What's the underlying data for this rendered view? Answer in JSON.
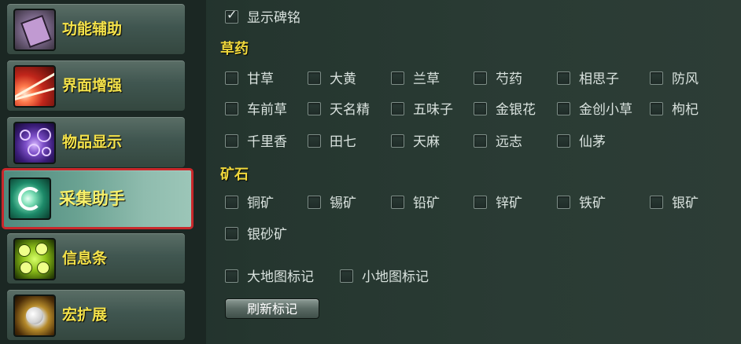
{
  "sidebar": {
    "items": [
      {
        "label": "功能辅助",
        "icon": "function-assist-icon"
      },
      {
        "label": "界面增强",
        "icon": "interface-enhance-icon"
      },
      {
        "label": "物品显示",
        "icon": "item-display-icon"
      },
      {
        "label": "采集助手",
        "icon": "gather-assist-icon",
        "selected": true
      },
      {
        "label": "信息条",
        "icon": "info-bar-icon"
      },
      {
        "label": "宏扩展",
        "icon": "macro-extension-icon"
      }
    ],
    "selected_highlight_color": "#c9282b"
  },
  "options": {
    "show_stele": {
      "label": "显示碑铭",
      "checked": true
    }
  },
  "herbs": {
    "title": "草药",
    "items": [
      "甘草",
      "大黄",
      "兰草",
      "芍药",
      "相思子",
      "防风",
      "车前草",
      "天名精",
      "五味子",
      "金银花",
      "金创小草",
      "枸杞",
      "千里香",
      "田七",
      "天麻",
      "远志",
      "仙茅"
    ]
  },
  "ores": {
    "title": "矿石",
    "items": [
      "铜矿",
      "锡矿",
      "铅矿",
      "锌矿",
      "铁矿",
      "银矿",
      "银砂矿"
    ]
  },
  "map_marks": {
    "world_map": "大地图标记",
    "mini_map": "小地图标记"
  },
  "refresh_button": "刷新标记",
  "colors": {
    "section_title": "#f0d83c",
    "nav_label": "#f4e24a",
    "option_text": "#d9e2de"
  }
}
